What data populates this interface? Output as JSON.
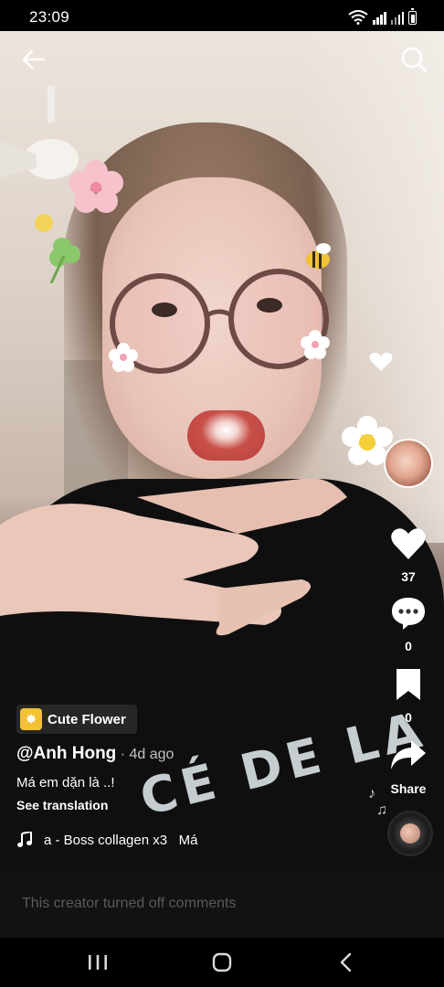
{
  "status_bar": {
    "time": "23:09"
  },
  "video": {
    "shirt_text": "CÉ DE LA"
  },
  "rail": {
    "likes_count": "37",
    "comments_count": "0",
    "bookmarks_count": "0",
    "share_label": "Share"
  },
  "effect": {
    "label": "Cute Flower"
  },
  "post": {
    "username": "@Anh Hong",
    "time_ago": " · 4d ago",
    "caption": "Má em dặn là ..!",
    "see_translation": "See translation",
    "sound": "a - Boss collagen x3   Má"
  },
  "comments": {
    "disabled_text": "This creator turned off comments"
  },
  "colors": {
    "effect_icon": "#f3c233",
    "comments_bar": "#121212",
    "muted_text": "#5a5a5a"
  }
}
